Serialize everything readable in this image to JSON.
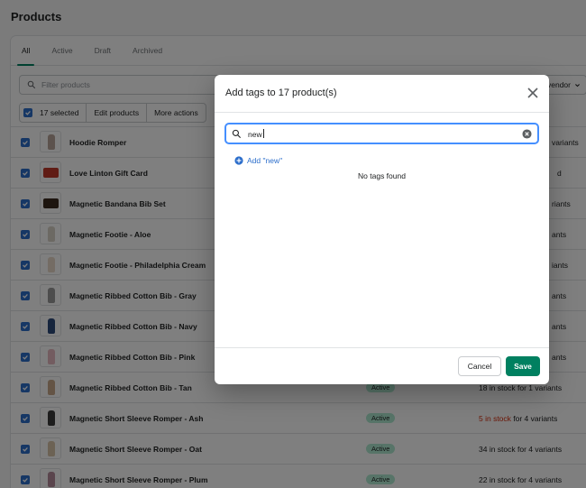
{
  "page": {
    "title": "Products"
  },
  "tabs": [
    "All",
    "Active",
    "Draft",
    "Archived"
  ],
  "filter": {
    "placeholder": "Filter products",
    "vendor_label": "vendor"
  },
  "bulk": {
    "selected": "17 selected",
    "edit": "Edit products",
    "more": "More actions"
  },
  "products": [
    {
      "name": "Hoodie Romper",
      "status": "",
      "inventory": "",
      "inventory_suffix": "variants",
      "thumb_color": "#b8a49a"
    },
    {
      "name": "Love Linton Gift Card",
      "status": "",
      "inventory": "",
      "inventory_suffix": "d",
      "thumb_color": "#c0392b"
    },
    {
      "name": "Magnetic Bandana Bib Set",
      "status": "",
      "inventory": "",
      "inventory_suffix": "riants",
      "thumb_color": "#3b2a1e"
    },
    {
      "name": "Magnetic Footie - Aloe",
      "status": "",
      "inventory": "",
      "inventory_suffix": "ants",
      "thumb_color": "#d9d2c6"
    },
    {
      "name": "Magnetic Footie - Philadelphia Cream",
      "status": "",
      "inventory": "",
      "inventory_suffix": "iants",
      "thumb_color": "#e8d8c8"
    },
    {
      "name": "Magnetic Ribbed Cotton Bib - Gray",
      "status": "",
      "inventory": "",
      "inventory_suffix": "ants",
      "thumb_color": "#9a9a9a"
    },
    {
      "name": "Magnetic Ribbed Cotton Bib - Navy",
      "status": "",
      "inventory": "",
      "inventory_suffix": "ants",
      "thumb_color": "#2c4a7a"
    },
    {
      "name": "Magnetic Ribbed Cotton Bib - Pink",
      "status": "",
      "inventory": "",
      "inventory_suffix": "ants",
      "thumb_color": "#e6b8c0"
    },
    {
      "name": "Magnetic Ribbed Cotton Bib - Tan",
      "status": "Active",
      "inventory": "18 in stock for 1 variants",
      "inventory_suffix": "",
      "thumb_color": "#c9a98a"
    },
    {
      "name": "Magnetic Short Sleeve Romper - Ash",
      "status": "Active",
      "inventory_red": "5 in stock",
      "inventory": " for 4 variants",
      "inventory_suffix": "",
      "thumb_color": "#3a3a3a"
    },
    {
      "name": "Magnetic Short Sleeve Romper - Oat",
      "status": "Active",
      "inventory": "34 in stock for 4 variants",
      "inventory_suffix": "",
      "thumb_color": "#d8c4a8"
    },
    {
      "name": "Magnetic Short Sleeve Romper - Plum",
      "status": "Active",
      "inventory": "22 in stock for 4 variants",
      "inventory_suffix": "",
      "thumb_color": "#b58a9a"
    }
  ],
  "modal": {
    "title": "Add tags to 17 product(s)",
    "search_value": "new",
    "add_label": "Add \"new\"",
    "empty_text": "No tags found",
    "cancel_label": "Cancel",
    "save_label": "Save"
  },
  "colors": {
    "accent": "#008060",
    "link": "#2c6ecb",
    "focus": "#458fff",
    "checkbox": "#2c6ecb",
    "badge": "#aee9d1",
    "danger": "#d72c0d"
  }
}
